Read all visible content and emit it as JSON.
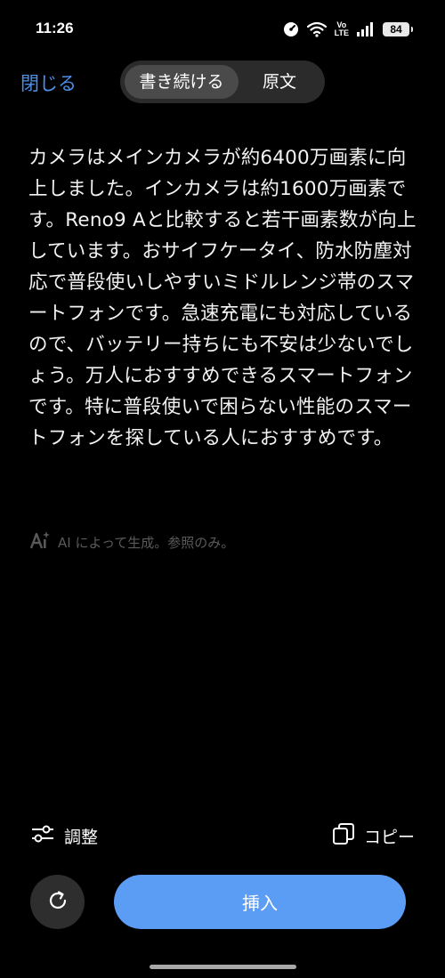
{
  "status_bar": {
    "time": "11:26",
    "volte_top": "Vo",
    "volte_bottom": "LTE",
    "battery": "84",
    "icons": [
      "gauge-icon",
      "wifi-icon",
      "volte-icon",
      "signal-icon",
      "battery-icon"
    ]
  },
  "header": {
    "close_label": "閉じる",
    "tabs": [
      {
        "label": "書き続ける",
        "active": true
      },
      {
        "label": "原文",
        "active": false
      }
    ]
  },
  "content": {
    "generated_text": "カメラはメインカメラが約6400万画素に向上しました。インカメラは約1600万画素です。Reno9 Aと比較すると若干画素数が向上しています。おサイフケータイ、防水防塵対応で普段使いしやすいミドルレンジ帯のスマートフォンです。急速充電にも対応しているので、バッテリー持ちにも不安は少ないでしょう。万人におすすめできるスマートフォンです。特に普段使いで困らない性能のスマートフォンを探している人におすすめです。",
    "ai_note": "AI によって生成。参照のみ。"
  },
  "actions": {
    "adjust_label": "調整",
    "copy_label": "コピー"
  },
  "footer": {
    "insert_label": "挿入"
  },
  "colors": {
    "accent_link": "#4b8fe6",
    "primary_button": "#5b9df5",
    "background": "#000000"
  }
}
